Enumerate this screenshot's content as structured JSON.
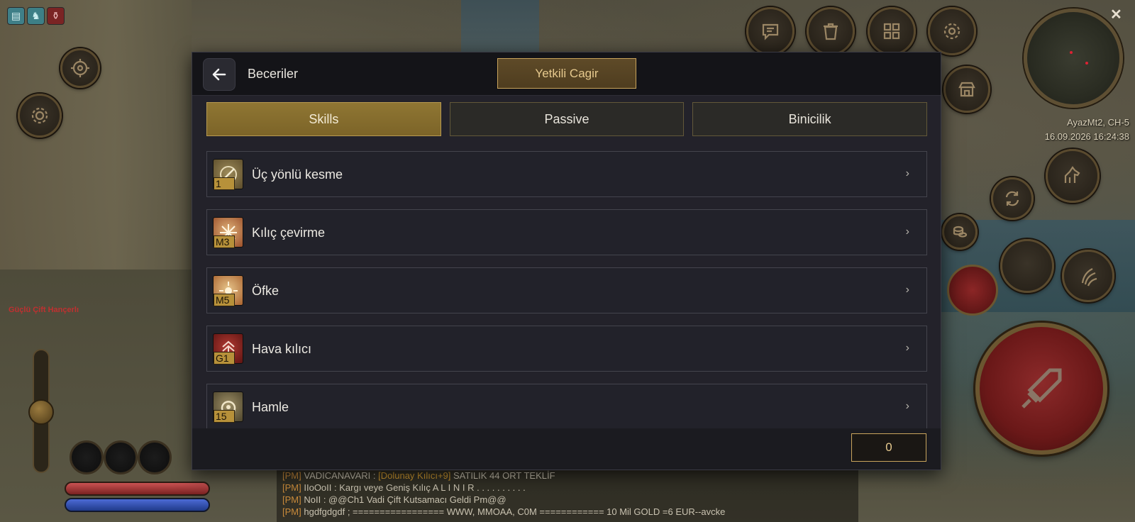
{
  "dialog": {
    "title": "Beceriler",
    "gm_call_label": "Yetkili Cagir",
    "tabs": [
      {
        "label": "Skills",
        "active": true
      },
      {
        "label": "Passive",
        "active": false
      },
      {
        "label": "Binicilik",
        "active": false
      }
    ],
    "skills": [
      {
        "name": "Üç yönlü kesme",
        "level": "1",
        "icon": "sword-slash-icon"
      },
      {
        "name": "Kılıç çevirme",
        "level": "M3",
        "icon": "spinning-blade-icon"
      },
      {
        "name": "Öfke",
        "level": "M5",
        "icon": "rage-burst-icon"
      },
      {
        "name": "Hava kılıcı",
        "level": "G1",
        "icon": "air-sword-icon"
      },
      {
        "name": "Hamle",
        "level": "15",
        "icon": "charge-icon"
      }
    ],
    "skill_points": "0",
    "chevron": "›",
    "back_icon": "arrow-left-icon"
  },
  "hud": {
    "server": "AyazMt2, CH-5",
    "datetime": "16.09.2026 16:24:38",
    "npc_label": "Güçlü Çift Hançerlı",
    "minimap_close": "✕"
  },
  "chat": [
    {
      "prefix": "[PM]",
      "sender": "VADICANAVARI",
      "item": "[Dolunay Kılıcı+9]",
      "text": "SATILIK 44 ORT TEKLİF"
    },
    {
      "prefix": "[PM]",
      "sender": "IIoOoII",
      "item": "",
      "text": "Kargı veye Geniş Kılıç A L I N I R . . . . . . . . . ."
    },
    {
      "prefix": "[PM]",
      "sender": "NoII",
      "item": "",
      "text": "@@Ch1  Vadi Çift Kutsamacı Geldi Pm@@"
    },
    {
      "prefix": "[PM]",
      "sender": "hgdfgdgdf",
      "item": "",
      "text": "================= WWW, MMOAA, C0M ============  10 Mil GOLD =6 EUR--avcke"
    }
  ],
  "colors": {
    "accent_gold": "#c9a45c",
    "tab_active": "#8f7633",
    "panel_bg": "#23222a",
    "attack_red": "#8c2a2a"
  }
}
